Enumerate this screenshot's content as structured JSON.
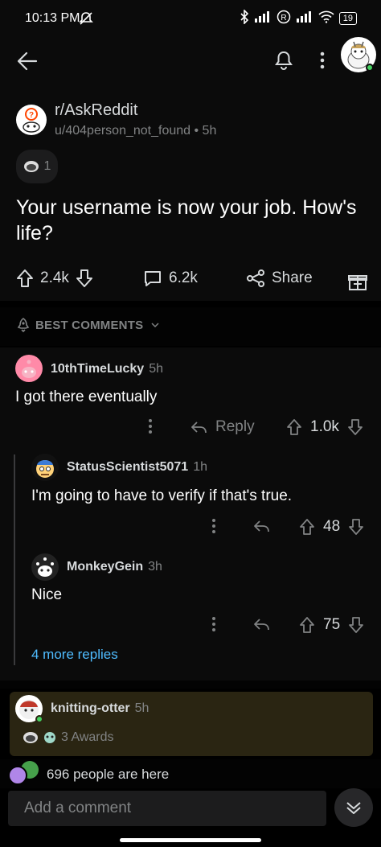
{
  "status_bar": {
    "time": "10:13 PM",
    "battery": "19"
  },
  "post": {
    "subreddit": "r/AskReddit",
    "author": "u/404person_not_found",
    "age": "5h",
    "award_count": "1",
    "title": "Your username is now your job. How's life?",
    "upvotes": "2.4k",
    "comments": "6.2k",
    "share_label": "Share"
  },
  "sort": {
    "label": "BEST COMMENTS"
  },
  "comments": [
    {
      "user": "10thTimeLucky",
      "age": "5h",
      "text": "I got there eventually",
      "reply_label": "Reply",
      "score": "1.0k",
      "replies": [
        {
          "user": "StatusScientist5071",
          "age": "1h",
          "text": "I'm going to have to verify if that's true.",
          "score": "48"
        },
        {
          "user": "MonkeyGein",
          "age": "3h",
          "text": "Nice",
          "score": "75"
        }
      ],
      "more_replies": "4 more replies"
    },
    {
      "user": "knitting-otter",
      "age": "5h",
      "awards": "3 Awards"
    }
  ],
  "presence": {
    "text": "696 people are here"
  },
  "composer": {
    "placeholder": "Add a comment"
  },
  "colors": {
    "background": "#0b0b0b",
    "text": "#d7dadc",
    "muted": "#818384",
    "link": "#4fbcff",
    "highlight": "#2a2512"
  }
}
